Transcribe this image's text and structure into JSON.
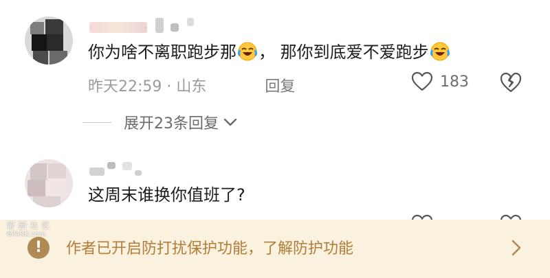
{
  "comments": [
    {
      "text_part1": "你为啥不离职跑步那",
      "text_part2": "， 那你到底爱不爱跑步",
      "time": "昨天22:59",
      "separator": "·",
      "location": "山东",
      "reply_label": "回复",
      "like_count": "183",
      "emoji": "rofl-emoji"
    },
    {
      "text": "这周末谁换你值班了?"
    }
  ],
  "expand": {
    "label": "展开23条回复"
  },
  "notice": {
    "text": "作者已开启防打扰保护功能，了解防护功能"
  },
  "watermark": {
    "logo_text": "留园社区",
    "url": "6PARK.com"
  },
  "colors": {
    "notice_bg": "#fbf1df",
    "notice_text": "#b07d38",
    "warn_icon": "#b08a52",
    "meta_gray": "#9b9b9b"
  }
}
